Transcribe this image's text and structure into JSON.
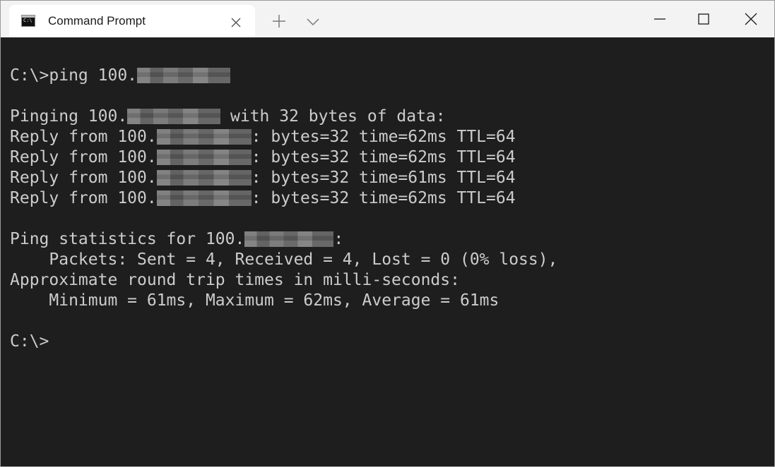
{
  "window": {
    "tab_title": "Command Prompt",
    "new_tab_glyph": "+",
    "icons": {
      "tab": "command-prompt-icon",
      "close_tab": "close-icon",
      "new_tab": "plus-icon",
      "dropdown": "chevron-down-icon",
      "minimize": "minimize-icon",
      "maximize": "maximize-icon",
      "close": "close-icon"
    }
  },
  "terminal": {
    "colors": {
      "background": "#1e1e1e",
      "text": "#cccccc"
    },
    "lines": {
      "cmd_prefix": "C:\\>ping 100.",
      "pinging_prefix": "Pinging 100.",
      "pinging_suffix": " with 32 bytes of data:",
      "reply_prefix": "Reply from 100.",
      "replies": [
        ": bytes=32 time=62ms TTL=64",
        ": bytes=32 time=62ms TTL=64",
        ": bytes=32 time=61ms TTL=64",
        ": bytes=32 time=62ms TTL=64"
      ],
      "stats_prefix": "Ping statistics for 100.",
      "stats_suffix": ":",
      "packets": "    Packets: Sent = 4, Received = 4, Lost = 0 (0% loss),",
      "approx": "Approximate round trip times in milli-seconds:",
      "minmax": "    Minimum = 61ms, Maximum = 62ms, Average = 61ms",
      "final_prompt": "C:\\>"
    }
  }
}
